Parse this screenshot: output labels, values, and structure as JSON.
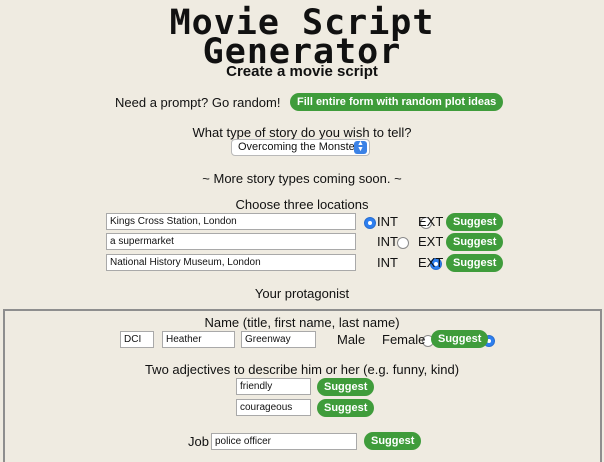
{
  "header": {
    "title_line1": "Movie Script",
    "title_line2": "Generator",
    "subtitle": "Create a movie script"
  },
  "prompt": {
    "label": "Need a prompt? Go random!",
    "button": "Fill entire form with random plot ideas"
  },
  "story": {
    "label": "What type of story do you wish to tell?",
    "selected": "Overcoming the Monster",
    "coming_soon": "~ More story types coming soon. ~"
  },
  "locations": {
    "label": "Choose three locations",
    "int_label": "INT",
    "ext_label": "EXT",
    "suggest_label": "Suggest",
    "items": [
      {
        "value": "Kings Cross Station, London",
        "mode": "INT"
      },
      {
        "value": "a supermarket",
        "mode": "EXT"
      },
      {
        "value": "National History Museum, London",
        "mode": "INT"
      }
    ]
  },
  "protagonist": {
    "heading": "Your protagonist",
    "name_label": "Name (title, first name, last name)",
    "title_value": "DCI",
    "first_name": "Heather",
    "last_name": "Greenway",
    "male_label": "Male",
    "female_label": "Female",
    "gender": "Female",
    "suggest_label": "Suggest",
    "adjectives_label": "Two adjectives to describe him or her (e.g. funny, kind)",
    "adjectives": [
      "friendly",
      "courageous"
    ],
    "job_label": "Job",
    "job_value": "police officer"
  }
}
